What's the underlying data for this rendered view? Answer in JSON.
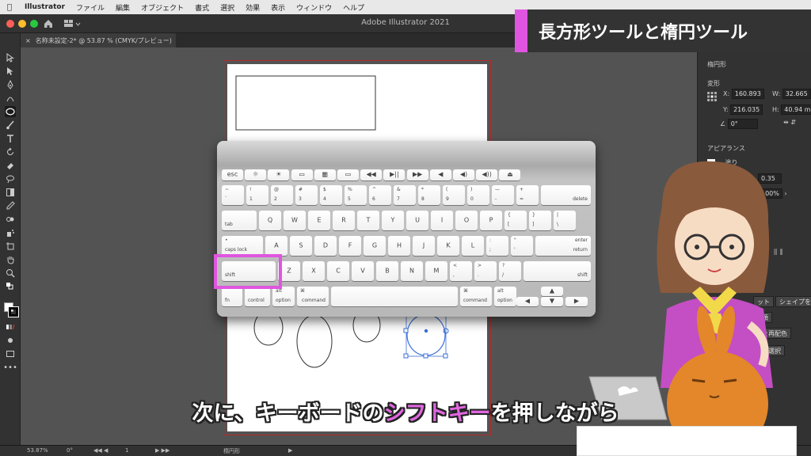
{
  "menubar": {
    "items": [
      "Illustrator",
      "ファイル",
      "編集",
      "オブジェクト",
      "書式",
      "選択",
      "効果",
      "表示",
      "ウィンドウ",
      "ヘルプ"
    ]
  },
  "window": {
    "title": "Adobe Illustrator 2021"
  },
  "document_tab": {
    "title": "名称未設定-2* @ 53.87 % (CMYK/プレビュー)"
  },
  "banner": {
    "text": "長方形ツールと楕円ツール",
    "accent_color": "#e055e0"
  },
  "subtitle": {
    "before": "次に、キーボードの",
    "highlight": "シフトキー",
    "after": "を押しながら"
  },
  "properties_panel": {
    "object_type": "楕円形",
    "transform_label": "変形",
    "x_label": "X:",
    "x_value": "160.893",
    "w_label": "W:",
    "w_value": "32.665",
    "y_label": "Y:",
    "y_value": "216.035",
    "h_label": "H:",
    "h_value": "40.94 m",
    "angle_value": "0°",
    "appearance_label": "アピアランス",
    "fill_label": "塗り",
    "stroke_value": "0.35",
    "opacity_value": "100%",
    "shape_button": "シェイプを",
    "overlap_label": "重ね順",
    "recolor_label": "クトを再配色",
    "select_label": "を一括選択",
    "button_partial": "ット"
  },
  "statusbar": {
    "zoom": "53.87%",
    "rotation": "0°",
    "artboard_num": "1",
    "tool_name": "楕円形"
  },
  "keyboard": {
    "fn_row": [
      "esc",
      "☼",
      "☀",
      "▭",
      "▦",
      "▭",
      "◀◀",
      "▶||",
      "▶▶",
      "◀",
      "◀)",
      "◀))",
      "⏏"
    ],
    "number_row": [
      [
        "~",
        "`"
      ],
      [
        "!",
        "1"
      ],
      [
        "@",
        "2"
      ],
      [
        "#",
        "3"
      ],
      [
        "$",
        "4"
      ],
      [
        "%",
        "5"
      ],
      [
        "^",
        "6"
      ],
      [
        "&",
        "7"
      ],
      [
        "*",
        "8"
      ],
      [
        "(",
        "9"
      ],
      [
        ")",
        "0"
      ],
      [
        "—",
        "-"
      ],
      [
        "+",
        "="
      ]
    ],
    "delete": "delete",
    "tab": "tab",
    "q_row": [
      "Q",
      "W",
      "E",
      "R",
      "T",
      "Y",
      "U",
      "I",
      "O",
      "P"
    ],
    "q_row_punct": [
      [
        "{",
        "["
      ],
      [
        "}",
        "]"
      ],
      [
        "|",
        "\\"
      ]
    ],
    "caps": "caps lock",
    "a_row": [
      "A",
      "S",
      "D",
      "F",
      "G",
      "H",
      "J",
      "K",
      "L"
    ],
    "a_row_punct": [
      [
        ":",
        ";"
      ],
      [
        "\"",
        "'"
      ]
    ],
    "enter_top": "enter",
    "enter_bottom": "return",
    "shift": "shift",
    "z_row": [
      "Z",
      "X",
      "C",
      "V",
      "B",
      "N",
      "M"
    ],
    "z_row_punct": [
      [
        "<",
        ","
      ],
      [
        ">",
        "."
      ],
      [
        "?",
        "/"
      ]
    ],
    "fn": "fn",
    "control": "control",
    "option": "option",
    "command": "command"
  }
}
